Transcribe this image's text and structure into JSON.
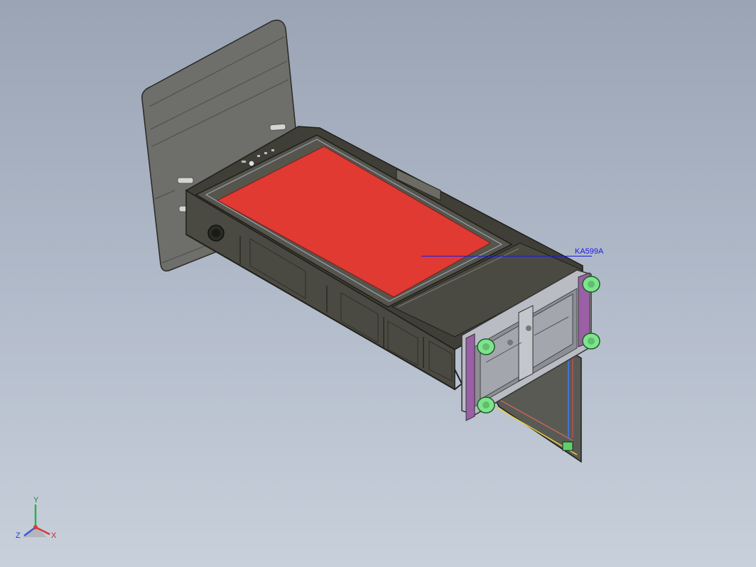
{
  "viewport": {
    "annotation_label": "KA599A",
    "colors": {
      "background_top": "#9aa4b4",
      "background_bottom": "#c8d0db",
      "housing": "#4b4b43",
      "screen": "#e03a33",
      "mount_plate": "#6e6e6a",
      "bracket": "#b9bcc3",
      "clamp": "#9a5fa5",
      "caster": "#7fe38d",
      "annotation": "#1a1ae6"
    }
  },
  "triad": {
    "x_label": "X",
    "y_label": "Y",
    "z_label": "Z"
  }
}
